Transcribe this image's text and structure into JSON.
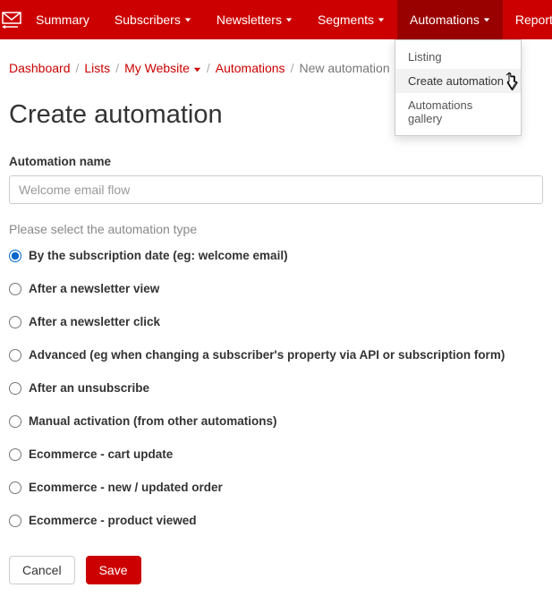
{
  "nav": {
    "items": [
      {
        "label": "Summary",
        "has_caret": false,
        "active": false
      },
      {
        "label": "Subscribers",
        "has_caret": true,
        "active": false
      },
      {
        "label": "Newsletters",
        "has_caret": true,
        "active": false
      },
      {
        "label": "Segments",
        "has_caret": true,
        "active": false
      },
      {
        "label": "Automations",
        "has_caret": true,
        "active": true
      },
      {
        "label": "Reports",
        "has_caret": true,
        "active": false
      }
    ]
  },
  "dropdown": {
    "items": [
      {
        "label": "Listing",
        "hl": false
      },
      {
        "label": "Create automation",
        "hl": true
      },
      {
        "label": "Automations gallery",
        "hl": false
      }
    ]
  },
  "breadcrumbs": {
    "dashboard": "Dashboard",
    "lists": "Lists",
    "site": "My Website",
    "automations": "Automations",
    "current": "New automation"
  },
  "page": {
    "title": "Create automation",
    "name_label": "Automation name",
    "name_placeholder": "Welcome email flow",
    "type_hint": "Please select the automation type"
  },
  "types": [
    {
      "label": "By the subscription date (eg: welcome email)",
      "checked": true
    },
    {
      "label": "After a newsletter view",
      "checked": false
    },
    {
      "label": "After a newsletter click",
      "checked": false
    },
    {
      "label": "Advanced (eg when changing a subscriber's property via API or subscription form)",
      "checked": false
    },
    {
      "label": "After an unsubscribe",
      "checked": false
    },
    {
      "label": "Manual activation (from other automations)",
      "checked": false
    },
    {
      "label": "Ecommerce - cart update",
      "checked": false
    },
    {
      "label": "Ecommerce - new / updated order",
      "checked": false
    },
    {
      "label": "Ecommerce - product viewed",
      "checked": false
    }
  ],
  "actions": {
    "cancel": "Cancel",
    "save": "Save"
  }
}
